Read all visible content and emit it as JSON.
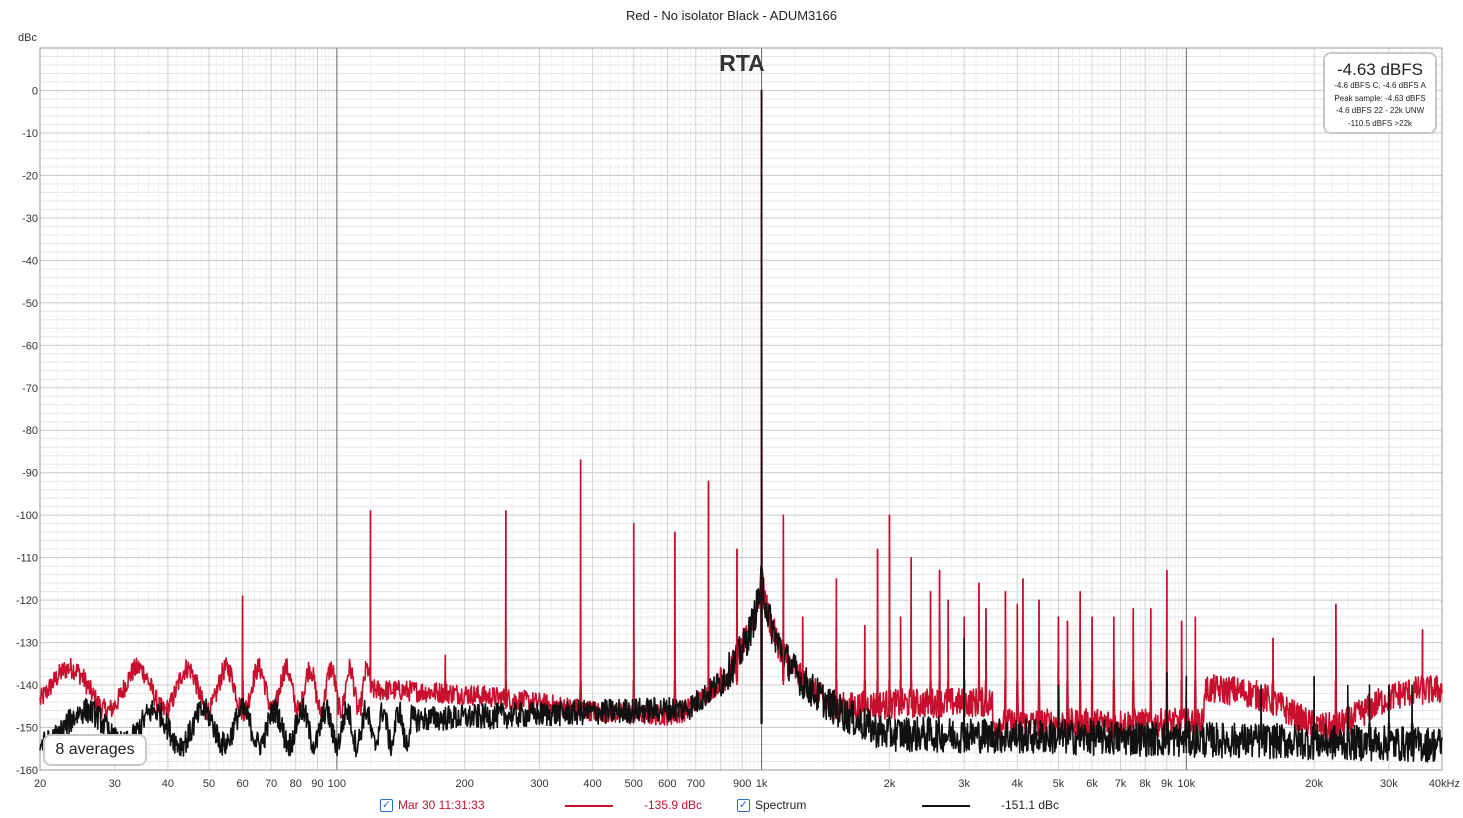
{
  "chart_data": {
    "type": "line",
    "title": "Red - No isolator Black - ADUM3166",
    "ylabel": "dBc",
    "ylim": [
      -160,
      10
    ],
    "yticks": [
      0,
      -10,
      -20,
      -30,
      -40,
      -50,
      -60,
      -70,
      -80,
      -90,
      -100,
      -110,
      -120,
      -130,
      -140,
      -150,
      -160
    ],
    "ytick_labels": [
      "0",
      "-10",
      "-20",
      "-30",
      "-40",
      "-50",
      "-60",
      "-70",
      "-80",
      "-90",
      "-100",
      "-110",
      "-120",
      "-130",
      "-140",
      "-150",
      "-160"
    ],
    "xscale": "log",
    "xlim": [
      20,
      40000
    ],
    "xticks": [
      20,
      30,
      40,
      50,
      60,
      70,
      80,
      90,
      100,
      200,
      300,
      400,
      500,
      600,
      700,
      900,
      1000,
      2000,
      3000,
      4000,
      5000,
      6000,
      7000,
      8000,
      9000,
      10000,
      20000,
      30000,
      40000
    ],
    "xtick_labels": [
      "20",
      "30",
      "40",
      "50",
      "60",
      "70",
      "80",
      "90",
      "100",
      "200",
      "300",
      "400",
      "500",
      "600",
      "700",
      "900",
      "1k",
      "2k",
      "3k",
      "4k",
      "5k",
      "6k",
      "7k",
      "8k",
      "9k",
      "10k",
      "20k",
      "30k",
      "40kHz"
    ],
    "grid": true,
    "fundamental_hz": 1000,
    "series": [
      {
        "name": "Mar 30 11:31:33",
        "color": "#c8102e",
        "noise_floor_dbc": -138,
        "peaks": [
          {
            "x": 60,
            "y": -119
          },
          {
            "x": 120,
            "y": -99
          },
          {
            "x": 180,
            "y": -133
          },
          {
            "x": 250,
            "y": -99
          },
          {
            "x": 375,
            "y": -87
          },
          {
            "x": 500,
            "y": -102
          },
          {
            "x": 625,
            "y": -104
          },
          {
            "x": 750,
            "y": -92
          },
          {
            "x": 875,
            "y": -108
          },
          {
            "x": 1000,
            "y": 0
          },
          {
            "x": 1125,
            "y": -100
          },
          {
            "x": 1250,
            "y": -124
          },
          {
            "x": 1500,
            "y": -115
          },
          {
            "x": 1750,
            "y": -126
          },
          {
            "x": 1875,
            "y": -108
          },
          {
            "x": 2000,
            "y": -100
          },
          {
            "x": 2125,
            "y": -124
          },
          {
            "x": 2250,
            "y": -110
          },
          {
            "x": 2500,
            "y": -118
          },
          {
            "x": 2625,
            "y": -113
          },
          {
            "x": 2750,
            "y": -120
          },
          {
            "x": 3000,
            "y": -124
          },
          {
            "x": 3250,
            "y": -116
          },
          {
            "x": 3375,
            "y": -122
          },
          {
            "x": 3750,
            "y": -118
          },
          {
            "x": 4000,
            "y": -121
          },
          {
            "x": 4125,
            "y": -115
          },
          {
            "x": 4500,
            "y": -120
          },
          {
            "x": 5000,
            "y": -124
          },
          {
            "x": 5250,
            "y": -125
          },
          {
            "x": 5625,
            "y": -118
          },
          {
            "x": 6000,
            "y": -124
          },
          {
            "x": 6750,
            "y": -124
          },
          {
            "x": 7500,
            "y": -122
          },
          {
            "x": 8250,
            "y": -122
          },
          {
            "x": 9000,
            "y": -113
          },
          {
            "x": 9750,
            "y": -125
          },
          {
            "x": 10500,
            "y": -124
          },
          {
            "x": 16000,
            "y": -129
          },
          {
            "x": 22500,
            "y": -121
          },
          {
            "x": 36000,
            "y": -127
          }
        ]
      },
      {
        "name": "Spectrum",
        "color": "#111111",
        "noise_floor_dbc": -152,
        "peaks": [
          {
            "x": 1000,
            "y": 0
          },
          {
            "x": 3000,
            "y": -129
          },
          {
            "x": 5000,
            "y": -140
          },
          {
            "x": 9000,
            "y": -137
          },
          {
            "x": 10000,
            "y": -138
          },
          {
            "x": 15000,
            "y": -140
          },
          {
            "x": 20000,
            "y": -138
          },
          {
            "x": 24000,
            "y": -141
          },
          {
            "x": 27000,
            "y": -140
          },
          {
            "x": 30000,
            "y": -143
          },
          {
            "x": 34000,
            "y": -140
          }
        ]
      }
    ],
    "annotations": {
      "rta_label": "RTA",
      "averages": "8 averages"
    }
  },
  "level_box": {
    "main": "-4.63 dBFS",
    "lines": [
      "-4.6 dBFS C, -4.6 dBFS A",
      "Peak sample: -4.63 dBFS",
      "-4.6 dBFS 22 - 22k UNW",
      "-110.5 dBFS >22k"
    ]
  },
  "legend": {
    "series1_label": "Mar 30 11:31:33",
    "series1_value": "-135.9 dBc",
    "series1_color": "#c8102e",
    "series2_label": "Spectrum",
    "series2_value": "-151.1 dBc",
    "series2_color": "#111111",
    "check_glyph": "✓"
  }
}
